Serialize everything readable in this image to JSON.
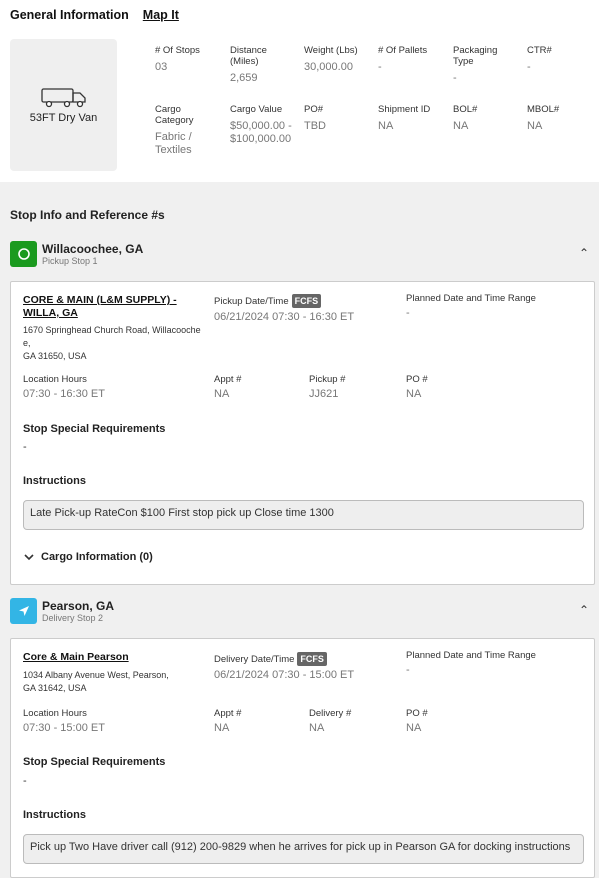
{
  "general": {
    "tab_general": "General Information",
    "tab_map": "Map It",
    "truck_label": "53FT Dry Van",
    "fields": [
      {
        "label": "# Of Stops",
        "value": "03"
      },
      {
        "label": "Distance (Miles)",
        "value": "2,659"
      },
      {
        "label": "Weight (Lbs)",
        "value": "30,000.00"
      },
      {
        "label": "# Of Pallets",
        "value": "-"
      },
      {
        "label": "Packaging Type",
        "value": "-"
      },
      {
        "label": "CTR#",
        "value": "-"
      },
      {
        "label": "Cargo Category",
        "value": "Fabric / Textiles"
      },
      {
        "label": "Cargo Value",
        "value": "$50,000.00 - $100,000.00"
      },
      {
        "label": "PO#",
        "value": "TBD"
      },
      {
        "label": "Shipment ID",
        "value": "NA"
      },
      {
        "label": "BOL#",
        "value": "NA"
      },
      {
        "label": "MBOL#",
        "value": "NA"
      }
    ]
  },
  "stops_section_title": "Stop Info and Reference #s",
  "stops": [
    {
      "city": "Willacoochee, GA",
      "sub": "Pickup Stop 1",
      "icon": "circle-icon",
      "facility": "CORE & MAIN (L&M SUPPLY) - WILLA, GA",
      "address_line1": "1670 Springhead Church Road, Willacoochee,",
      "address_line2": "GA 31650, USA",
      "date_label": "Pickup Date/Time",
      "fcfs": "FCFS",
      "date_value": "06/21/2024 07:30 - 16:30 ET",
      "planned_label": "Planned Date and Time Range",
      "planned_value": "-",
      "hours_label": "Location Hours",
      "hours_value": "07:30 - 16:30 ET",
      "appt_label": "Appt #",
      "appt_value": "NA",
      "ref_label": "Pickup #",
      "ref_value": "JJ621",
      "po_label": "PO #",
      "po_value": "NA",
      "special_label": "Stop Special Requirements",
      "special_value": "-",
      "instructions_label": "Instructions",
      "instructions": "Late Pick-up RateCon $100 First stop pick up Close time 1300",
      "cargo_label": "Cargo Information (0)"
    },
    {
      "city": "Pearson, GA",
      "sub": "Delivery Stop 2",
      "icon": "navigation-arrow-icon",
      "facility": "Core & Main Pearson",
      "address_line1": "1034 Albany Avenue West, Pearson,",
      "address_line2": "GA 31642, USA",
      "date_label": "Delivery Date/Time",
      "fcfs": "FCFS",
      "date_value": "06/21/2024 07:30 - 15:00 ET",
      "planned_label": "Planned Date and Time Range",
      "planned_value": "-",
      "hours_label": "Location Hours",
      "hours_value": "07:30 - 15:00 ET",
      "appt_label": "Appt #",
      "appt_value": "NA",
      "ref_label": "Delivery #",
      "ref_value": "NA",
      "po_label": "PO #",
      "po_value": "NA",
      "special_label": "Stop Special Requirements",
      "special_value": "-",
      "instructions_label": "Instructions",
      "instructions": "Pick up Two Have driver call (912) 200-9829 when he arrives for pick up in Pearson GA for docking instructions"
    }
  ],
  "colors": {
    "pickup": "#1b9a1f",
    "delivery": "#33b5e5"
  }
}
